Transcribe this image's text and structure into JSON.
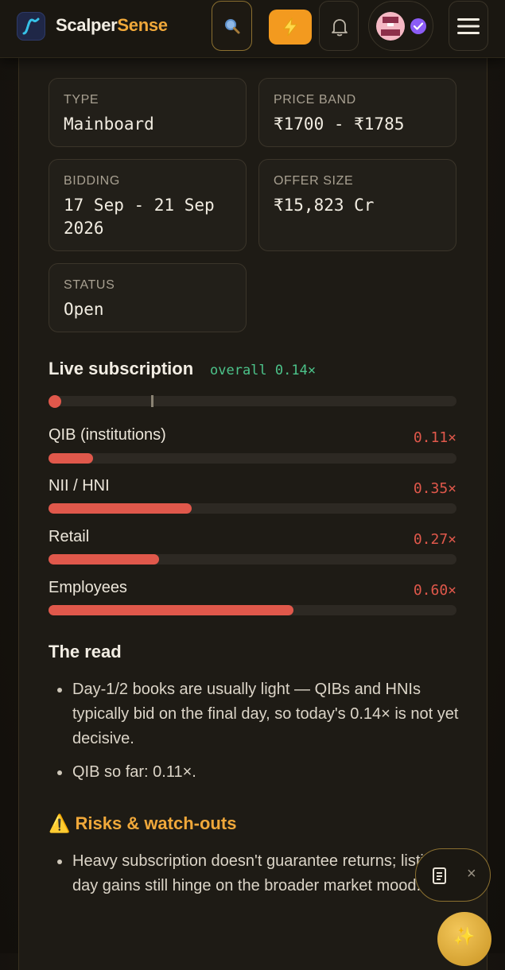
{
  "nav": {
    "brand_part1": "Scalper",
    "brand_part2": "Sense",
    "logo_icon": "trend-line-icon",
    "search_icon": "search-icon",
    "bolt_icon": "lightning-icon",
    "bell_icon": "bell-icon",
    "avatar_icon": "pixel-avatar-icon",
    "verified_icon": "verified-check-icon",
    "menu_icon": "hamburger-menu-icon"
  },
  "details": [
    {
      "label": "TYPE",
      "value": "Mainboard"
    },
    {
      "label": "PRICE BAND",
      "value": "₹1700 - ₹1785"
    },
    {
      "label": "BIDDING",
      "value": "17 Sep - 21 Sep 2026"
    },
    {
      "label": "OFFER SIZE",
      "value": "₹15,823 Cr"
    },
    {
      "label": "STATUS",
      "value": "Open"
    }
  ],
  "subscription": {
    "title": "Live subscription",
    "overall_text": "overall 0.14×",
    "overall_value": 0.14,
    "rows": [
      {
        "label": "QIB (institutions)",
        "value_text": "0.11×",
        "value": 0.11
      },
      {
        "label": "NII / HNI",
        "value_text": "0.35×",
        "value": 0.35
      },
      {
        "label": "Retail",
        "value_text": "0.27×",
        "value": 0.27
      },
      {
        "label": "Employees",
        "value_text": "0.60×",
        "value": 0.6
      }
    ]
  },
  "read": {
    "title": "The read",
    "bullets": [
      "Day-1/2 books are usually light — QIBs and HNIs typically bid on the final day, so today's 0.14× is not yet decisive.",
      "QIB so far: 0.11×."
    ]
  },
  "risks": {
    "title": "⚠️ Risks & watch-outs",
    "bullets": [
      "Heavy subscription doesn't guarantee returns; listing-day gains still hinge on the broader market mood."
    ]
  },
  "floating": {
    "doc_icon": "document-icon",
    "close_label": "×",
    "fab_icon": "sparkles-icon",
    "fab_label": "✨"
  },
  "colors": {
    "accent": "#f0a83a",
    "bolt_button": "#f39a1f",
    "bar_fill": "#e0584b",
    "overall_green": "#4cc38a",
    "verified": "#8b5cf6"
  }
}
